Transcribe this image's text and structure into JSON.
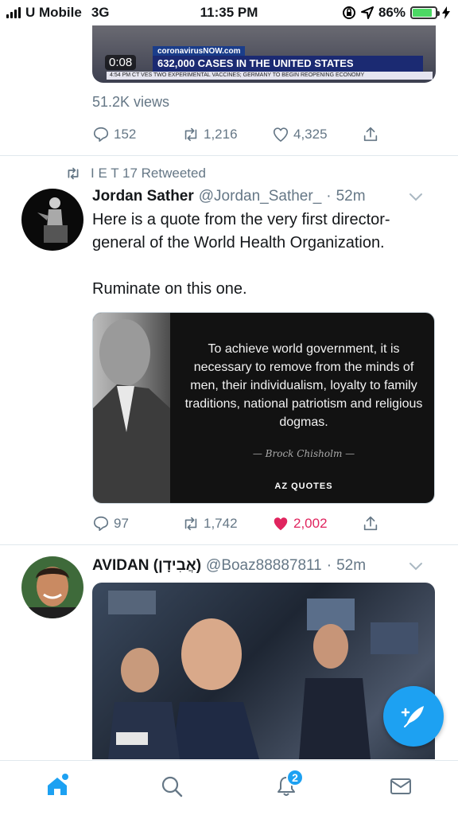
{
  "status_bar": {
    "carrier": "U Mobile",
    "network": "3G",
    "time": "11:35 PM",
    "battery_percent": "86%",
    "battery_level": 0.86,
    "colors": {
      "battery": "#4cd964"
    }
  },
  "tweet_1": {
    "media": {
      "duration": "0:08",
      "ticker_logo": "coronavirusNOW.com",
      "banner": "632,000 CASES IN THE UNITED STATES",
      "crawl": "4:54 PM CT   VES TWO EXPERIMENTAL VACCINES; GERMANY TO BEGIN REOPENING ECONOMY"
    },
    "views": "51.2K views",
    "actions": {
      "replies": "152",
      "retweets": "1,216",
      "likes": "4,325"
    }
  },
  "tweet_2": {
    "retweeted_by": "I E T 17 Retweeted",
    "name": "Jordan Sather",
    "handle": "@Jordan_Sather_",
    "dot": "·",
    "time": "52m",
    "text_line1": "Here is a quote from the very first director-general of the World Health Organization.",
    "text_line2": "Ruminate on this one.",
    "quote_card": {
      "quote": "To achieve world government, it is necessary to remove from the minds of men, their individualism, loyalty to family traditions, national patriotism and religious dogmas.",
      "author": "— Brock Chisholm —",
      "brand": "AZ QUOTES"
    },
    "actions": {
      "replies": "97",
      "retweets": "1,742",
      "likes": "2,002",
      "liked": true
    },
    "colors": {
      "like_active": "#e0245e"
    }
  },
  "tweet_3": {
    "name": "AVIDAN (אֲבִידָן)",
    "handle": "@Boaz88887811",
    "dot": "·",
    "time": "52m"
  },
  "tab_bar": {
    "notifications_badge": "2",
    "tabs": [
      "home-icon",
      "search-icon",
      "bell-icon",
      "mail-icon"
    ]
  },
  "colors": {
    "accent": "#1da1f2",
    "secondary_text": "#657786"
  }
}
